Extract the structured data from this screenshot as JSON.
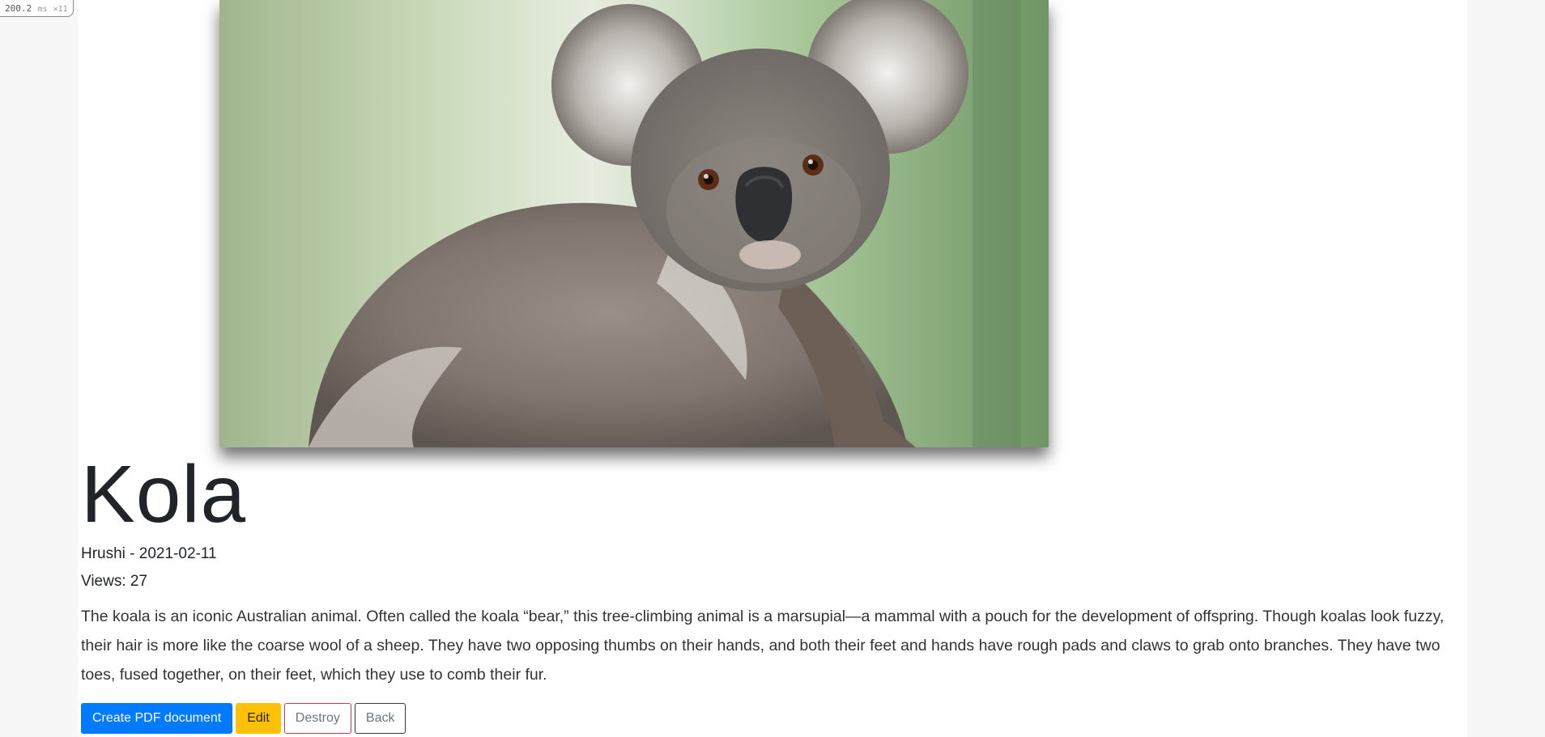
{
  "profiler": {
    "value": "200.2",
    "unit": "ms",
    "count": "×11"
  },
  "article": {
    "image_subject": "koala-photo",
    "title": "Kola",
    "author_date": "Hrushi - 2021-02-11",
    "views": "Views: 27",
    "description": "The koala is an iconic Australian animal. Often called the koala “bear,” this tree-climbing animal is a marsupial—a mammal with a pouch for the development of offspring. Though koalas look fuzzy, their hair is more like the coarse wool of a sheep. They have two opposing thumbs on their hands, and both their feet and hands have rough pads and claws to grab onto branches. They have two toes, fused together, on their feet, which they use to comb their fur."
  },
  "actions": {
    "create_pdf": "Create PDF document",
    "edit": "Edit",
    "destroy": "Destroy",
    "back": "Back"
  },
  "colors": {
    "primary": "#007bff",
    "warning": "#ffc107",
    "danger": "#dc3545",
    "dark": "#343a40",
    "page_background": "#f7f7f7",
    "content_background": "#ffffff"
  }
}
